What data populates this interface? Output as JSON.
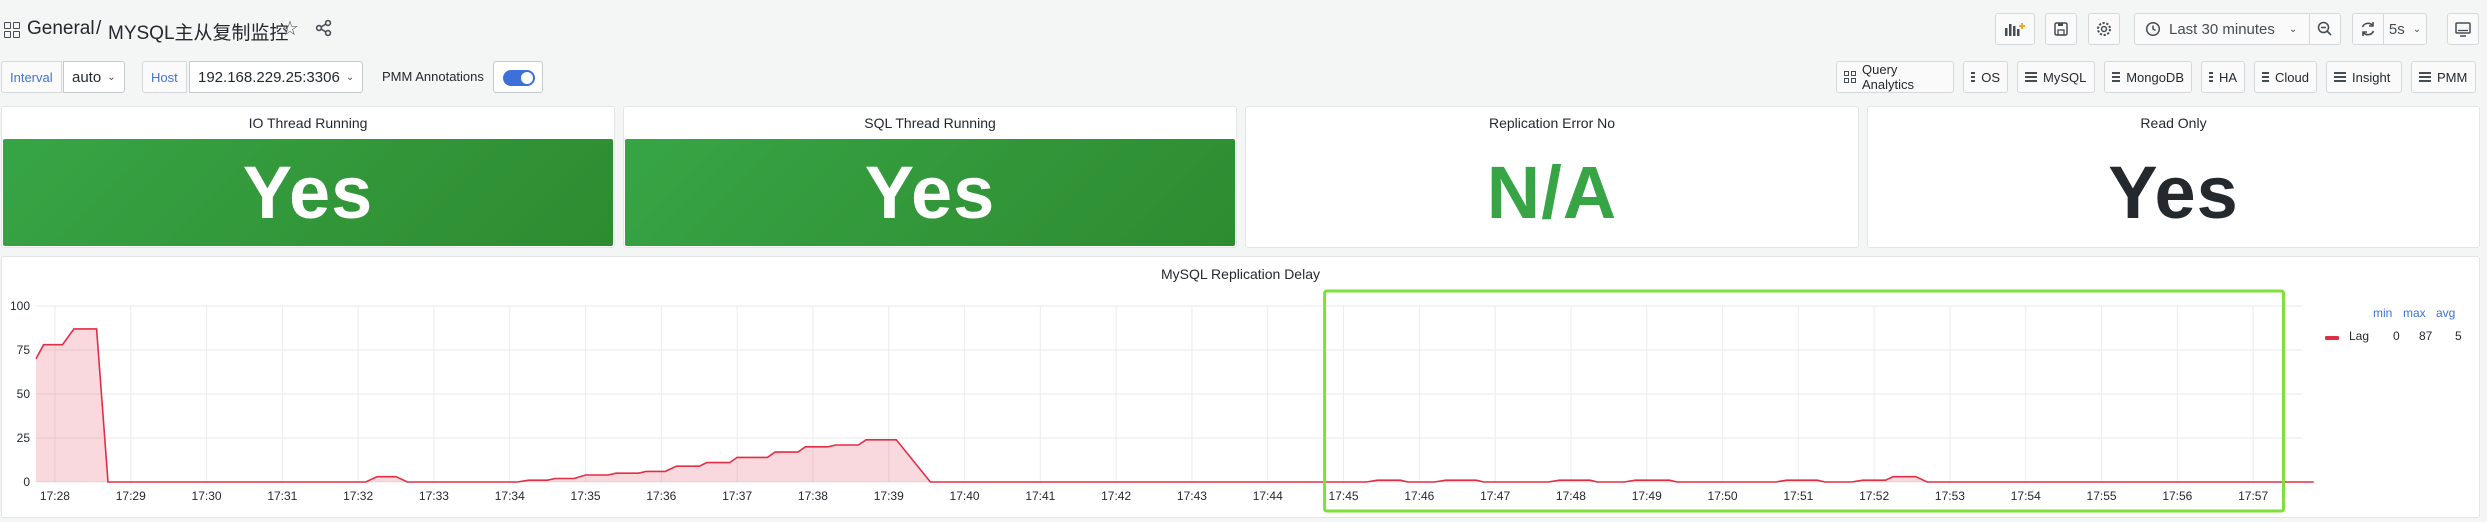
{
  "breadcrumb": {
    "folder": "General",
    "separator": "/",
    "dashboard": "MYSQL主从复制监控"
  },
  "toolbar": {
    "time_range": "Last 30 minutes",
    "refresh_interval": "5s"
  },
  "variables": {
    "interval": {
      "label": "Interval",
      "value": "auto"
    },
    "host": {
      "label": "Host",
      "value": "192.168.229.25:3306"
    },
    "annotations": {
      "label": "PMM Annotations",
      "enabled": true
    }
  },
  "nav_links": [
    "Query Analytics",
    "OS",
    "MySQL",
    "MongoDB",
    "HA",
    "Cloud",
    "Insight",
    "PMM"
  ],
  "stats": [
    {
      "title": "IO Thread Running",
      "value": "Yes",
      "style": "green-bg"
    },
    {
      "title": "SQL Thread Running",
      "value": "Yes",
      "style": "green-bg"
    },
    {
      "title": "Replication Error No",
      "value": "N/A",
      "style": "green-text"
    },
    {
      "title": "Read Only",
      "value": "Yes",
      "style": "plain"
    }
  ],
  "colors": {
    "accent": "#3d71d9",
    "ok_green": "#37a545",
    "series_red": "#e02f44",
    "highlight": "#7ee03a"
  },
  "chart_data": {
    "type": "area",
    "title": "MySQL Replication Delay",
    "ylim": [
      0,
      100
    ],
    "y_ticks": [
      "0",
      "25",
      "50",
      "75",
      "100"
    ],
    "x_ticks": [
      "17:28",
      "17:29",
      "17:30",
      "17:31",
      "17:32",
      "17:33",
      "17:34",
      "17:35",
      "17:36",
      "17:37",
      "17:38",
      "17:39",
      "17:40",
      "17:41",
      "17:42",
      "17:43",
      "17:44",
      "17:45",
      "17:46",
      "17:47",
      "17:48",
      "17:49",
      "17:50",
      "17:51",
      "17:52",
      "17:53",
      "17:54",
      "17:55",
      "17:56",
      "17:57"
    ],
    "x_minutes_range": [
      27.75,
      57.8
    ],
    "grid": true,
    "legend": {
      "placement": "right",
      "headers": [
        "min",
        "max",
        "avg"
      ]
    },
    "series": [
      {
        "name": "Lag",
        "min": "0",
        "max": "87",
        "avg": "5",
        "points": [
          [
            27.75,
            70
          ],
          [
            27.85,
            78
          ],
          [
            28.1,
            78
          ],
          [
            28.25,
            87
          ],
          [
            28.55,
            87
          ],
          [
            28.7,
            0
          ],
          [
            32.1,
            0
          ],
          [
            32.25,
            3
          ],
          [
            32.5,
            3
          ],
          [
            32.65,
            0
          ],
          [
            34.1,
            0
          ],
          [
            34.25,
            1
          ],
          [
            34.5,
            1
          ],
          [
            34.6,
            2
          ],
          [
            34.85,
            2
          ],
          [
            35.0,
            4
          ],
          [
            35.3,
            4
          ],
          [
            35.4,
            5
          ],
          [
            35.7,
            5
          ],
          [
            35.8,
            6
          ],
          [
            36.05,
            6
          ],
          [
            36.2,
            9
          ],
          [
            36.5,
            9
          ],
          [
            36.6,
            11
          ],
          [
            36.9,
            11
          ],
          [
            37.0,
            14
          ],
          [
            37.4,
            14
          ],
          [
            37.5,
            17
          ],
          [
            37.8,
            17
          ],
          [
            37.9,
            20
          ],
          [
            38.2,
            20
          ],
          [
            38.3,
            21
          ],
          [
            38.6,
            21
          ],
          [
            38.7,
            24
          ],
          [
            39.0,
            24
          ],
          [
            39.1,
            24
          ],
          [
            39.55,
            0
          ],
          [
            45.3,
            0
          ],
          [
            45.45,
            1
          ],
          [
            45.75,
            1
          ],
          [
            45.85,
            0
          ],
          [
            46.2,
            0
          ],
          [
            46.35,
            1
          ],
          [
            46.75,
            1
          ],
          [
            46.85,
            0
          ],
          [
            47.7,
            0
          ],
          [
            47.85,
            1
          ],
          [
            48.25,
            1
          ],
          [
            48.35,
            0
          ],
          [
            48.7,
            0
          ],
          [
            48.85,
            1
          ],
          [
            49.3,
            1
          ],
          [
            49.4,
            0
          ],
          [
            50.7,
            0
          ],
          [
            50.85,
            1
          ],
          [
            51.25,
            1
          ],
          [
            51.35,
            0
          ],
          [
            51.7,
            0
          ],
          [
            51.85,
            1
          ],
          [
            52.15,
            1
          ],
          [
            52.25,
            3
          ],
          [
            52.55,
            3
          ],
          [
            52.7,
            0
          ],
          [
            57.8,
            0
          ]
        ]
      }
    ],
    "highlight_range": [
      44.75,
      57.4
    ]
  }
}
